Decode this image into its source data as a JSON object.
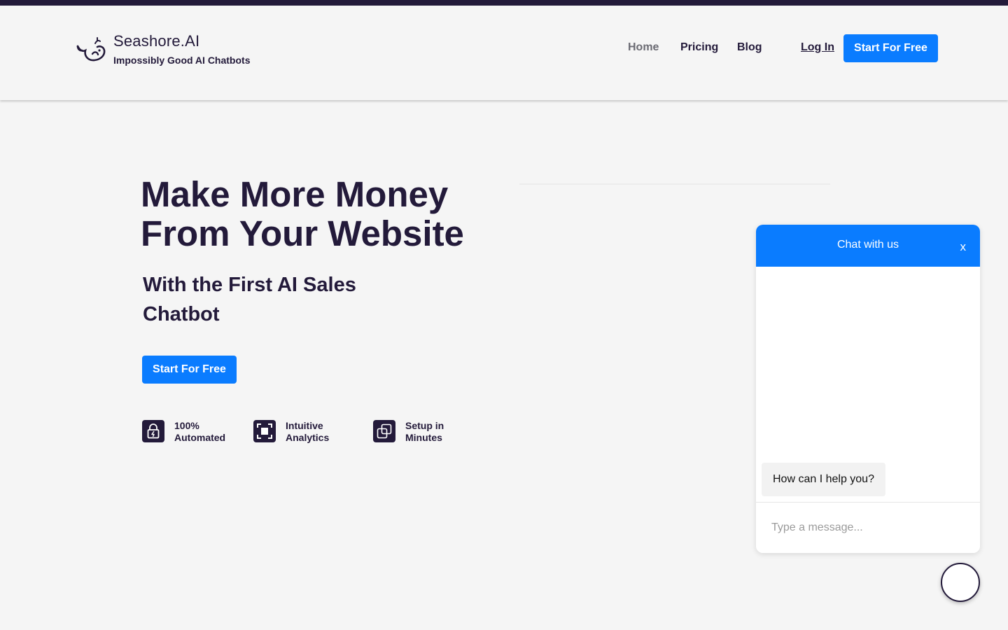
{
  "brand": {
    "name": "Seashore.AI",
    "tagline": "Impossibly Good AI Chatbots"
  },
  "nav": {
    "home": "Home",
    "pricing": "Pricing",
    "blog": "Blog",
    "login": "Log In",
    "cta": "Start For Free"
  },
  "hero": {
    "title": "Make More Money From Your Website",
    "subtitle": "With the First AI Sales Chatbot",
    "cta": "Start For Free"
  },
  "features": [
    {
      "label": "100%\nAutomated",
      "icon": "lock-bolt-icon"
    },
    {
      "label": "Intuitive\nAnalytics",
      "icon": "frame-square-icon"
    },
    {
      "label": "Setup in\nMinutes",
      "icon": "copy-squares-icon"
    }
  ],
  "chat": {
    "title": "Chat with us",
    "close": "x",
    "bot_message": "How can I help you?",
    "input_placeholder": "Type a message..."
  },
  "launcher": {
    "glyph": ""
  },
  "colors": {
    "primary": "#0a7cff",
    "dark": "#231a3a",
    "background": "#f5f5f5"
  }
}
